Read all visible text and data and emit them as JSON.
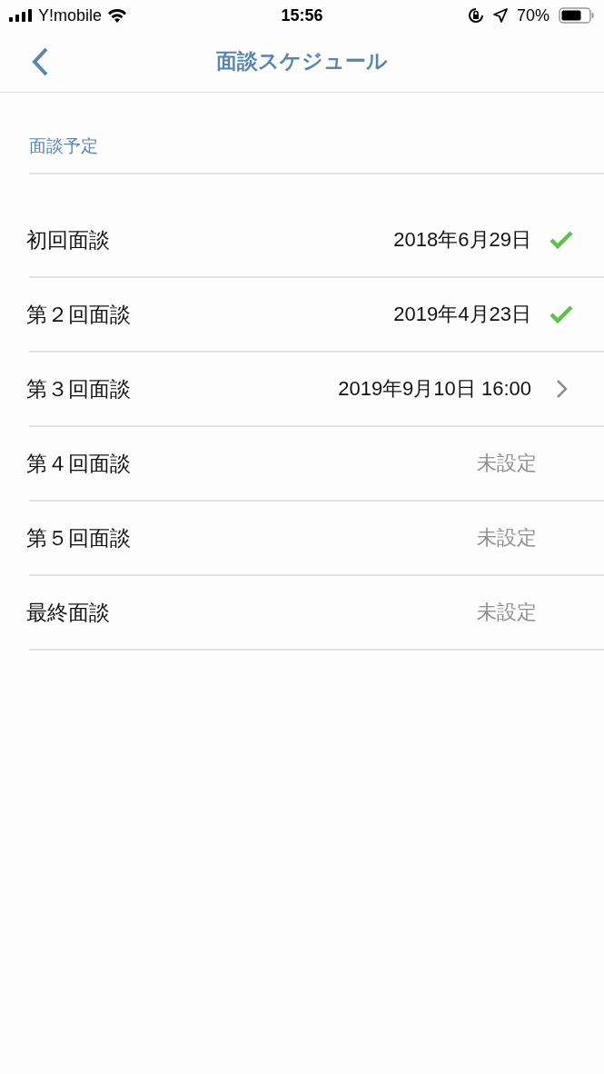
{
  "status_bar": {
    "carrier": "Y!mobile",
    "time": "15:56",
    "battery": "70%"
  },
  "nav": {
    "title": "面談スケジュール"
  },
  "section": {
    "title": "面談予定"
  },
  "rows": [
    {
      "label": "初回面談",
      "value": "2018年6月29日",
      "kind": "done"
    },
    {
      "label": "第２回面談",
      "value": "2019年4月23日",
      "kind": "done"
    },
    {
      "label": "第３回面談",
      "value": "2019年9月10日 16:00",
      "kind": "scheduled"
    },
    {
      "label": "第４回面談",
      "value": "未設定",
      "kind": "unset"
    },
    {
      "label": "第５回面談",
      "value": "未設定",
      "kind": "unset"
    },
    {
      "label": "最終面談",
      "value": "未設定",
      "kind": "unset"
    }
  ]
}
